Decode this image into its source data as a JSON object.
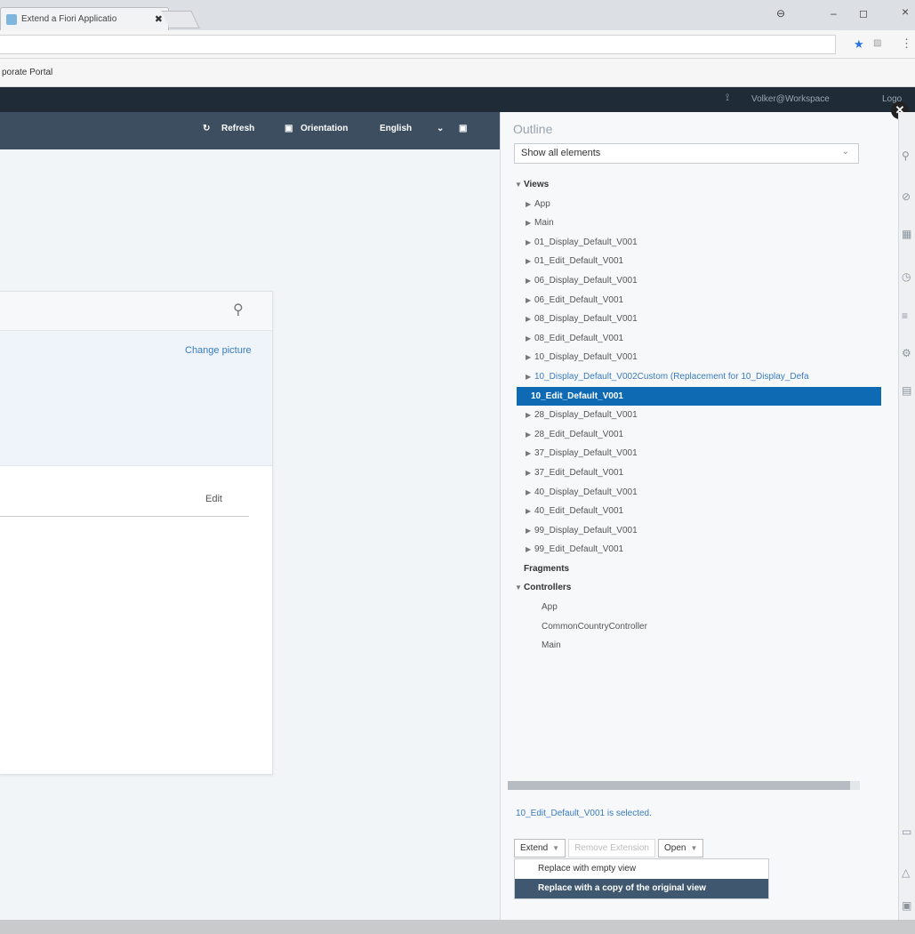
{
  "browser": {
    "tab_title": "Extend a Fiori Applicatio",
    "tab_close": "✖",
    "bookmark": "porate Portal",
    "win_profile": "⊖",
    "win_min": "–",
    "win_max": "◻",
    "win_close": "×"
  },
  "shell": {
    "user": "Volker@Workspace",
    "logout": "Logo"
  },
  "toolbar": {
    "refresh": "Refresh",
    "orientation": "Orientation",
    "language": "English"
  },
  "card": {
    "change_picture": "Change picture",
    "edit": "Edit"
  },
  "outline": {
    "title": "Outline",
    "filter_value": "Show all elements",
    "tree": {
      "views": "Views",
      "view_items": [
        "App",
        "Main",
        "01_Display_Default_V001",
        "01_Edit_Default_V001",
        "06_Display_Default_V001",
        "06_Edit_Default_V001",
        "08_Display_Default_V001",
        "08_Edit_Default_V001",
        "10_Display_Default_V001",
        "10_Display_Default_V002Custom (Replacement for 10_Display_Defa",
        "10_Edit_Default_V001",
        "28_Display_Default_V001",
        "28_Edit_Default_V001",
        "37_Display_Default_V001",
        "37_Edit_Default_V001",
        "40_Display_Default_V001",
        "40_Edit_Default_V001",
        "99_Display_Default_V001",
        "99_Edit_Default_V001"
      ],
      "fragments": "Fragments",
      "controllers": "Controllers",
      "controller_items": [
        "App",
        "CommonCountryController",
        "Main"
      ]
    },
    "selected_message": "10_Edit_Default_V001 is selected.",
    "buttons": {
      "extend": "Extend",
      "remove": "Remove Extension",
      "open": "Open"
    },
    "menu": {
      "empty": "Replace with empty view",
      "copy": "Replace with a copy of the original view"
    }
  },
  "colors": {
    "selected": "#0f6ab4",
    "link": "#3a7bbf",
    "toolbar": "#3c4e60",
    "shellbar": "#1f2c38"
  }
}
